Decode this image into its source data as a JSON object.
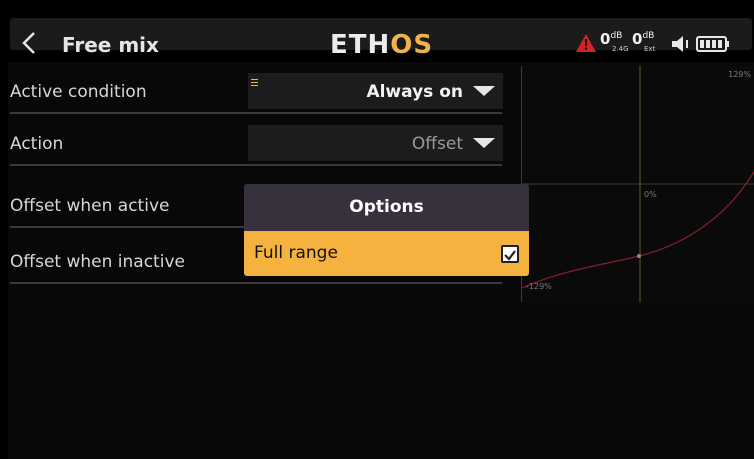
{
  "header": {
    "title": "Free mix",
    "logo_main": "ETH",
    "logo_accent": "OS",
    "rssi1": {
      "value": "0",
      "unit": "dB",
      "sub": "2.4G"
    },
    "rssi2": {
      "value": "0",
      "unit": "dB",
      "sub": "Ext"
    }
  },
  "rows": [
    {
      "label": "Active condition",
      "value": "Always on"
    },
    {
      "label": "Action",
      "value": "Offset"
    },
    {
      "label": "Offset when active"
    },
    {
      "label": "Offset when inactive"
    }
  ],
  "graph": {
    "top_label": "129%",
    "center_label": "0%",
    "bottom_label": "-129%",
    "curve_color": "#8a1e2a"
  },
  "dialog": {
    "title": "Options",
    "item_label": "Full range",
    "item_checked": true
  },
  "colors": {
    "accent": "#f6b23e",
    "warning": "#d32222"
  }
}
